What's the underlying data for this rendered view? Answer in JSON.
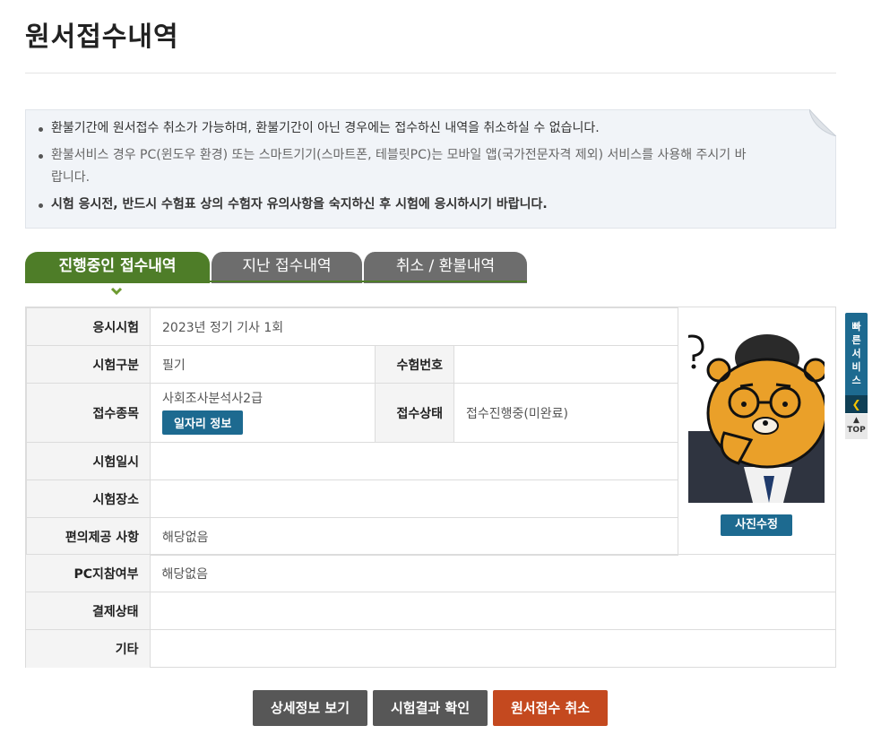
{
  "page": {
    "title": "원서접수내역"
  },
  "notice": {
    "items": [
      "환불기간에 원서접수 취소가 가능하며, 환불기간이 아닌 경우에는 접수하신 내역을 취소하실 수 없습니다.",
      "환불서비스 경우 PC(윈도우 환경) 또는 스마트기기(스마트폰, 테블릿PC)는 모바일 앱(국가전문자격 제외) 서비스를 사용해 주시기 바랍니다.",
      "시험 응시전, 반드시 수험표 상의 수험자 유의사항을 숙지하신 후 시험에 응시하시기 바랍니다."
    ]
  },
  "tabs": [
    {
      "label": "진행중인 접수내역",
      "active": true
    },
    {
      "label": "지난 접수내역",
      "active": false
    },
    {
      "label": "취소 / 환불내역",
      "active": false
    }
  ],
  "info": {
    "exam_name_label": "응시시험",
    "exam_name_value": "2023년 정기 기사 1회",
    "exam_type_label": "시험구분",
    "exam_type_value": "필기",
    "exam_number_label": "수험번호",
    "exam_number_value": "",
    "category_label": "접수종목",
    "category_value": "사회조사분석사2급",
    "job_info_button": "일자리 정보",
    "status_label": "접수상태",
    "status_value": "접수진행중(미완료)",
    "exam_date_label": "시험일시",
    "exam_date_value": "",
    "exam_place_label": "시험장소",
    "exam_place_value": "",
    "accommodation_label": "편의제공 사항",
    "accommodation_value": "해당없음",
    "pc_label": "PC지참여부",
    "pc_value": "해당없음",
    "payment_label": "결제상태",
    "payment_value": "",
    "etc_label": "기타",
    "etc_value": ""
  },
  "photo": {
    "edit_button": "사진수정"
  },
  "quick_menu": {
    "label": "빠른서비스",
    "top_label": "TOP"
  },
  "actions": {
    "detail": "상세정보 보기",
    "result": "시험결과 확인",
    "cancel": "원서접수 취소"
  },
  "colors": {
    "active_tab": "#4e7d28",
    "inactive_tab": "#6d6d6d",
    "primary_button": "#1d6a90",
    "danger_button": "#c4491f",
    "status_text": "#d42a1a"
  }
}
